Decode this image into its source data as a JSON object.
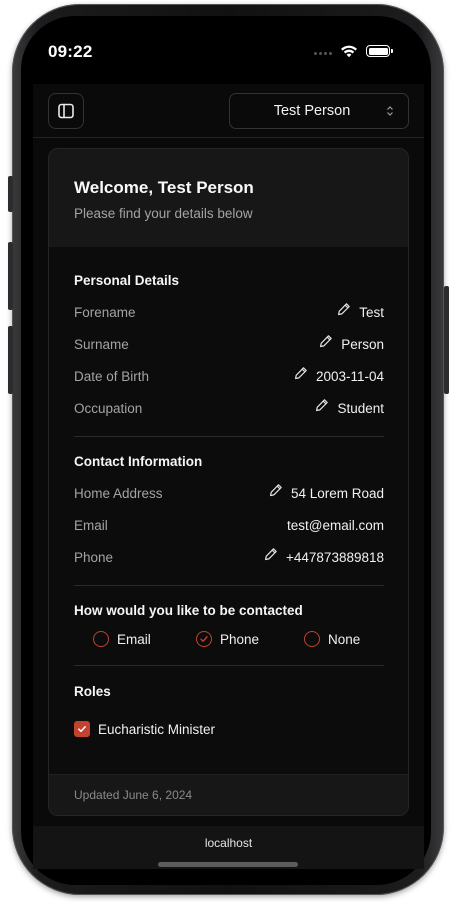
{
  "status_bar": {
    "time": "09:22"
  },
  "header": {
    "selected_user": "Test Person"
  },
  "card": {
    "title": "Welcome, Test Person",
    "subtitle": "Please find your details below",
    "personal": {
      "title": "Personal Details",
      "rows": [
        {
          "label": "Forename",
          "value": "Test",
          "editable": true
        },
        {
          "label": "Surname",
          "value": "Person",
          "editable": true
        },
        {
          "label": "Date of Birth",
          "value": "2003-11-04",
          "editable": true
        },
        {
          "label": "Occupation",
          "value": "Student",
          "editable": true
        }
      ]
    },
    "contact": {
      "title": "Contact Information",
      "rows": [
        {
          "label": "Home Address",
          "value": "54 Lorem Road",
          "editable": true
        },
        {
          "label": "Email",
          "value": "test@email.com",
          "editable": false
        },
        {
          "label": "Phone",
          "value": "+447873889818",
          "editable": true
        }
      ]
    },
    "contact_pref": {
      "title": "How would you like to be contacted",
      "options": [
        {
          "label": "Email",
          "checked": false
        },
        {
          "label": "Phone",
          "checked": true
        },
        {
          "label": "None",
          "checked": false
        }
      ]
    },
    "roles": {
      "title": "Roles",
      "items": [
        {
          "label": "Eucharistic Minister",
          "checked": true
        }
      ]
    },
    "footer": "Updated June 6, 2024"
  },
  "browser": {
    "url": "localhost"
  },
  "colors": {
    "accent": "#c2412f",
    "background": "#0a0a0a",
    "card_header": "#171717"
  },
  "icons": [
    "sidebar-toggle-icon",
    "chevron-up-down-icon",
    "pencil-icon",
    "check-icon",
    "wifi-icon",
    "battery-icon"
  ]
}
